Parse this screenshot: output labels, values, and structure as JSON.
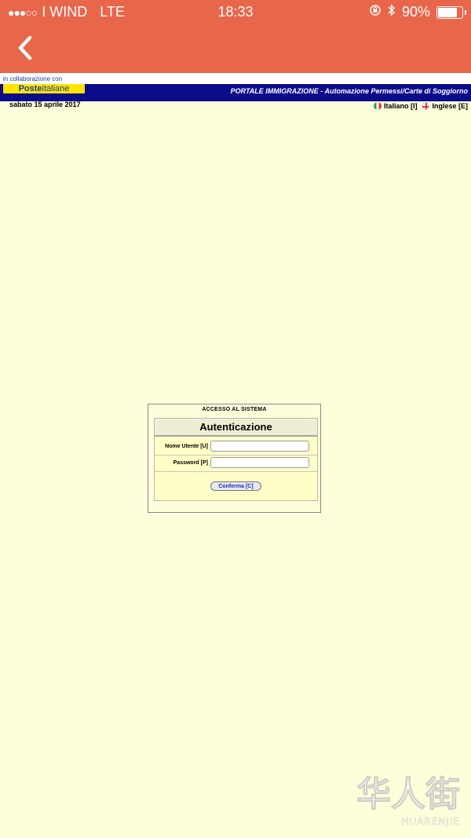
{
  "status_bar": {
    "signal_dots": "●●●○○",
    "carrier": "I WIND",
    "network": "LTE",
    "time": "18:33",
    "battery_percent": "90%",
    "battery_level": 0.9
  },
  "nav": {
    "back_icon": "chevron-left-icon"
  },
  "header": {
    "collab_text": "in collaborazione con",
    "logo_bold": "Poste",
    "logo_light": "italiane",
    "portal_title": "PORTALE IMMIGRAZIONE - Automazione Permessi/Carte di Soggiorno",
    "date": "sabato 15 aprile 2017",
    "lang_italian": "Italiano [I]",
    "lang_english": "Inglese [E]"
  },
  "login": {
    "legend": "ACCESSO AL SISTEMA",
    "title": "Autenticazione",
    "username_label": "Nome Utente [U]",
    "username_value": "",
    "password_label": "Password [P]",
    "password_value": "",
    "confirm_label": "Conferma [C]"
  },
  "watermark": {
    "chinese": "华人街",
    "latin": "HUARENJIE"
  },
  "colors": {
    "nav_bg": "#e8664a",
    "page_bg": "#fffedb",
    "title_bar_bg": "#0c0c8a",
    "logo_yellow": "#ffe400"
  }
}
